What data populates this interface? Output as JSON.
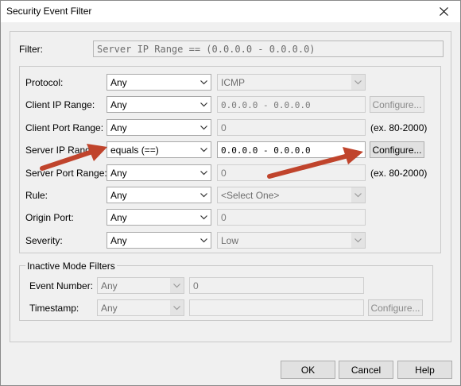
{
  "window": {
    "title": "Security Event Filter"
  },
  "filter": {
    "label": "Filter:",
    "expression": "Server IP Range == (0.0.0.0 - 0.0.0.0)"
  },
  "rows": [
    {
      "label": "Protocol:",
      "operator": "Any",
      "value": "ICMP",
      "value_type": "combo"
    },
    {
      "label": "Client IP Range:",
      "operator": "Any",
      "value": "0.0.0.0 - 0.0.0.0",
      "value_type": "text",
      "button": "Configure..."
    },
    {
      "label": "Client Port Range:",
      "operator": "Any",
      "value": "0",
      "value_type": "text",
      "hint": "(ex. 80-2000)"
    },
    {
      "label": "Server IP Range:",
      "operator": "equals (==)",
      "value": "0.0.0.0 - 0.0.0.0",
      "value_type": "text",
      "button": "Configure..."
    },
    {
      "label": "Server Port Range:",
      "operator": "Any",
      "value": "0",
      "value_type": "text",
      "hint": "(ex. 80-2000)"
    },
    {
      "label": "Rule:",
      "operator": "Any",
      "value": "<Select One>",
      "value_type": "combo"
    },
    {
      "label": "Origin Port:",
      "operator": "Any",
      "value": "0",
      "value_type": "text"
    },
    {
      "label": "Severity:",
      "operator": "Any",
      "value": "Low",
      "value_type": "combo"
    }
  ],
  "inactive": {
    "title": "Inactive Mode Filters",
    "event_number": {
      "label": "Event Number:",
      "operator": "Any",
      "value": "0"
    },
    "timestamp": {
      "label": "Timestamp:",
      "operator": "Any",
      "value": "",
      "button": "Configure..."
    }
  },
  "buttons": {
    "ok": "OK",
    "cancel": "Cancel",
    "help": "Help"
  },
  "colors": {
    "annotation_arrow": "#c0442c"
  }
}
